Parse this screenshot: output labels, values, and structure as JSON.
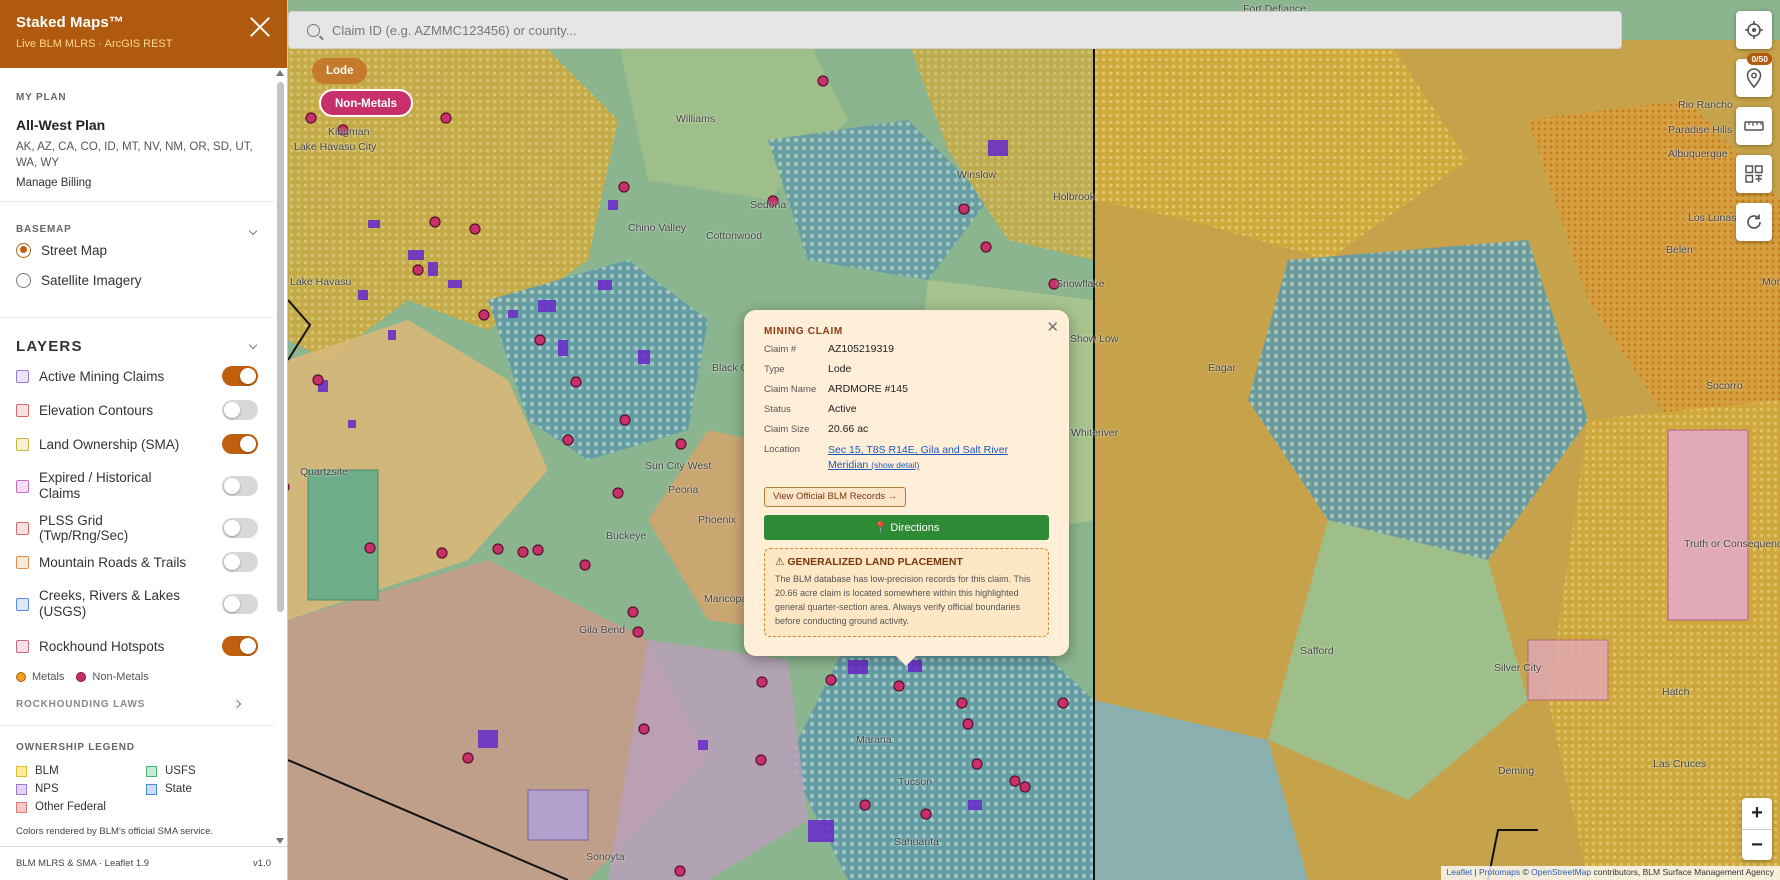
{
  "sidebar": {
    "title": "Staked Maps™",
    "subtitle": "Live BLM MLRS · ArcGIS REST",
    "plan": {
      "section_label": "MY PLAN",
      "name": "All-West Plan",
      "states": "AK, AZ, CA, CO, ID, MT, NV, NM, OR, SD, UT, WA, WY",
      "billing": "Manage Billing"
    },
    "basemap": {
      "section_label": "BASEMAP",
      "options": [
        {
          "label": "Street Map",
          "selected": true
        },
        {
          "label": "Satellite Imagery",
          "selected": false
        }
      ]
    },
    "layers": {
      "title": "LAYERS",
      "items": [
        {
          "label": "Active Mining Claims",
          "on": true,
          "swatch": "#9b7ad6"
        },
        {
          "label": "Elevation Contours",
          "on": false,
          "swatch": "#d86a6a"
        },
        {
          "label": "Land Ownership (SMA)",
          "on": true,
          "swatch": "#c9b43a"
        },
        {
          "label": "Expired / Historical Claims",
          "on": false,
          "swatch": "#c86ac8"
        },
        {
          "label": "PLSS Grid (Twp/Rng/Sec)",
          "on": false,
          "swatch": "#d86a6a"
        },
        {
          "label": "Mountain Roads & Trails",
          "on": false,
          "swatch": "#e0904a"
        },
        {
          "label": "Creeks, Rivers & Lakes (USGS)",
          "on": false,
          "swatch": "#5a8ad8"
        },
        {
          "label": "Rockhound Hotspots",
          "on": true,
          "swatch": "#c86a8a"
        }
      ],
      "legend_metals": "Metals",
      "legend_nonmetals": "Non-Metals",
      "laws_label": "ROCKHOUNDING LAWS"
    },
    "ownership": {
      "section_label": "OWNERSHIP LEGEND",
      "items": [
        {
          "label": "BLM",
          "color": "#f2d64a"
        },
        {
          "label": "USFS",
          "color": "#5cc07a"
        },
        {
          "label": "NPS",
          "color": "#a98ad8"
        },
        {
          "label": "State",
          "color": "#5a9ae0"
        },
        {
          "label": "Other Federal",
          "color": "#e88a8a"
        }
      ],
      "note": "Colors rendered by BLM's official SMA service."
    },
    "footer": {
      "left": "BLM MLRS & SMA · Leaflet 1.9",
      "right": "v1.0"
    }
  },
  "map": {
    "search_placeholder": "Claim ID (e.g. AZMMC123456) or county...",
    "chips": {
      "lode": "Lode",
      "nonmetals": "Non-Metals"
    },
    "pin_badge": "0/50",
    "zoom_in": "+",
    "zoom_out": "−",
    "attribution": {
      "leaflet": "Leaflet",
      "sep": " | ",
      "protomaps": "Protomaps",
      "rest": " © ",
      "osm": "OpenStreetMap",
      "tail": " contributors, BLM Surface Management Agency"
    },
    "places": [
      "Fort Defiance",
      "Kingman",
      "Williams",
      "Sedona",
      "Chino Valley",
      "Cottonwood",
      "Winslow",
      "Holbrook",
      "Snowflake",
      "Show Low",
      "Black Canyon",
      "Whiteriver",
      "Sun City West",
      "Peoria",
      "Phoenix",
      "Buckeye",
      "Maricopa",
      "Gila Bend",
      "Safford",
      "Marana",
      "Tucson",
      "Sahuarita",
      "Sonoyta",
      "Lake Havasu",
      "Quartzsite",
      "Rio Rancho",
      "Paradise Hills",
      "Albuquerque",
      "Belen",
      "Los Lunas",
      "Socorro",
      "Truth or Consequences",
      "Silver City",
      "Deming",
      "Hatch",
      "Las Cruces",
      "Lake Havasu City",
      "Eagar",
      "Moriarty"
    ]
  },
  "popup": {
    "heading": "MINING CLAIM",
    "fields": [
      {
        "key": "Claim #",
        "value": "AZ105219319"
      },
      {
        "key": "Type",
        "value": "Lode"
      },
      {
        "key": "Claim Name",
        "value": "ARDMORE #145"
      },
      {
        "key": "Status",
        "value": "Active"
      },
      {
        "key": "Claim Size",
        "value": "20.66 ac"
      }
    ],
    "location_key": "Location",
    "location_value": "Sec 15, T8S R14E, Gila and Salt River Meridian",
    "location_detail": "(show detail)",
    "records_button": "View Official BLM Records →",
    "directions_button": "📍 Directions",
    "warning_title": "⚠ GENERALIZED LAND PLACEMENT",
    "warning_body": "The BLM database has low-precision records for this claim. This 20.66 acre claim is located somewhere within this highlighted general quarter-section area. Always verify official boundaries before conducting ground activity."
  }
}
